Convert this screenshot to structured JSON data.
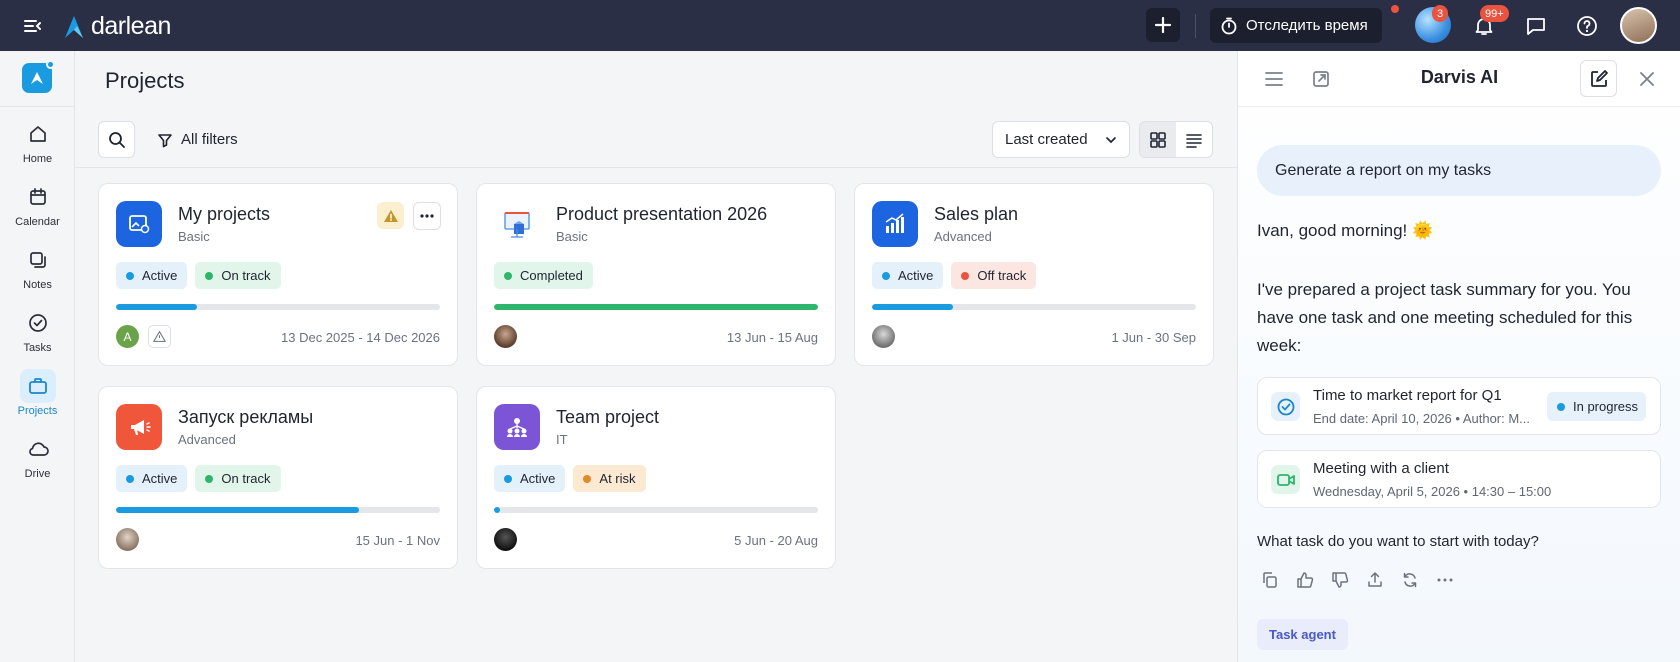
{
  "topbar": {
    "logo_text": "darlean",
    "track_time_label": "Отследить время",
    "ai_badge": "3",
    "notifications_badge": "99+"
  },
  "nav": {
    "items": [
      {
        "label": "Home",
        "icon": "home-icon"
      },
      {
        "label": "Calendar",
        "icon": "calendar-icon"
      },
      {
        "label": "Notes",
        "icon": "notes-icon"
      },
      {
        "label": "Tasks",
        "icon": "tasks-icon"
      },
      {
        "label": "Projects",
        "icon": "projects-icon",
        "active": true
      },
      {
        "label": "Drive",
        "icon": "cloud-icon"
      }
    ]
  },
  "main": {
    "title": "Projects",
    "filters_label": "All filters",
    "sort_label": "Last created"
  },
  "projects": [
    {
      "title": "My projects",
      "type": "Basic",
      "tags": [
        {
          "label": "Active",
          "color": "#1a9be0",
          "bg": "#e4f1fb"
        },
        {
          "label": "On track",
          "color": "#2db56b",
          "bg": "#e2f5ea"
        }
      ],
      "progress": 0.25,
      "progress_color": "#1a9be0",
      "dates": "13 Dec 2025 - 14 Dec 2026",
      "avatar_letter": "A"
    },
    {
      "title": "Product presentation 2026",
      "type": "Basic",
      "tags": [
        {
          "label": "Completed",
          "color": "#2db56b",
          "bg": "#e2f5ea"
        }
      ],
      "progress": 1.0,
      "progress_color": "#2db56b",
      "dates": "13 Jun - 15 Aug"
    },
    {
      "title": "Sales plan",
      "type": "Advanced",
      "tags": [
        {
          "label": "Active",
          "color": "#1a9be0",
          "bg": "#e4f1fb"
        },
        {
          "label": "Off track",
          "color": "#e9533f",
          "bg": "#fce6e2"
        }
      ],
      "progress": 0.25,
      "progress_color": "#1a9be0",
      "dates": "1 Jun - 30 Sep"
    },
    {
      "title": "Запуск рекламы",
      "type": "Advanced",
      "tags": [
        {
          "label": "Active",
          "color": "#1a9be0",
          "bg": "#e4f1fb"
        },
        {
          "label": "On track",
          "color": "#2db56b",
          "bg": "#e2f5ea"
        }
      ],
      "progress": 0.75,
      "progress_color": "#1a9be0",
      "dates": "15 Jun - 1 Nov"
    },
    {
      "title": "Team project",
      "type": "IT",
      "tags": [
        {
          "label": "Active",
          "color": "#1a9be0",
          "bg": "#e4f1fb"
        },
        {
          "label": "At risk",
          "color": "#e08a2a",
          "bg": "#fbe9d2"
        }
      ],
      "progress": 0.02,
      "progress_color": "#1a9be0",
      "dates": "5 Jun - 20 Aug"
    }
  ],
  "ai": {
    "title": "Darvis AI",
    "user_message": "Generate a report on my tasks",
    "greeting": "Ivan, good morning! 🌞",
    "summary": "I've prepared a project task summary for you. You have one task and one meeting scheduled for this week:",
    "items": [
      {
        "title": "Time to market report for Q1",
        "subtitle": "End date: April 10, 2026 • Author: M...",
        "status": "In progress"
      },
      {
        "title": "Meeting with a client",
        "subtitle": "Wednesday, April 5, 2026 • 14:30 – 15:00"
      }
    ],
    "question": "What task do you want to start with today?",
    "agent_label": "Task agent"
  }
}
